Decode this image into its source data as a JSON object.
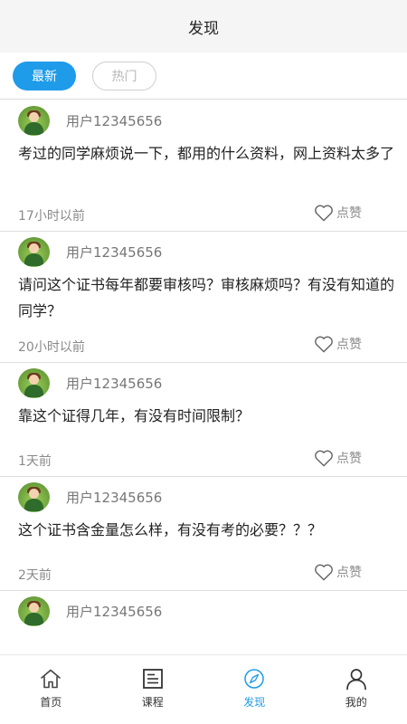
{
  "header": {
    "title": "发现"
  },
  "filters": {
    "latest_label": "最新",
    "hot_label": "热门"
  },
  "posts": [
    {
      "username": "用户12345656",
      "content": "考过的同学麻烦说一下，都用的什么资料，网上资料太多了",
      "time": "17小时以前",
      "like_label": "点赞"
    },
    {
      "username": "用户12345656",
      "content": "请问这个证书每年都要审核吗？审核麻烦吗？有没有知道的同学？",
      "time": "20小时以前",
      "like_label": "点赞"
    },
    {
      "username": "用户12345656",
      "content": "靠这个证得几年，有没有时间限制？",
      "time": "1天前",
      "like_label": "点赞"
    },
    {
      "username": "用户12345656",
      "content": "这个证书含金量怎么样，有没有考的必要？？？",
      "time": "2天前",
      "like_label": "点赞"
    },
    {
      "username": "用户12345656"
    }
  ],
  "tabbar": {
    "home_label": "首页",
    "course_label": "课程",
    "discover_label": "发现",
    "mine_label": "我的"
  },
  "colors": {
    "accent": "#1e9be9",
    "muted": "#8a8a8a"
  },
  "icons": [
    "heart-icon",
    "home-icon",
    "course-icon",
    "compass-icon",
    "user-icon"
  ]
}
